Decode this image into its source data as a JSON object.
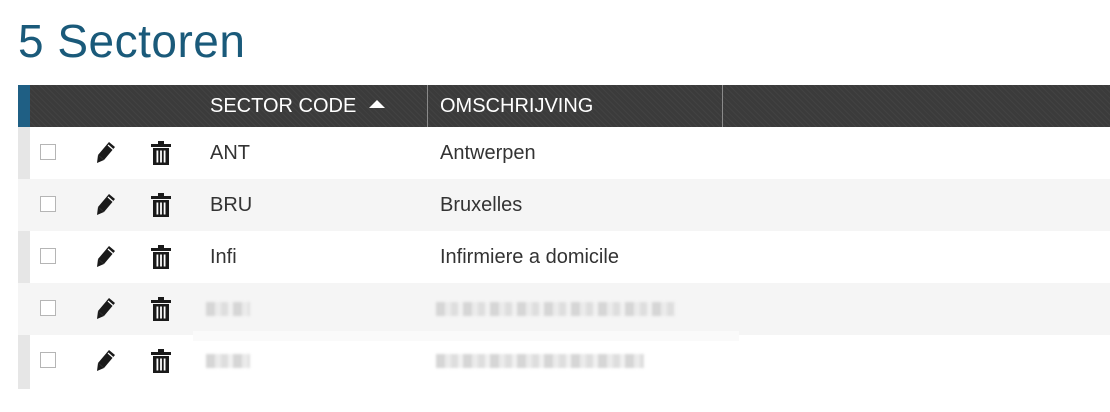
{
  "page": {
    "title": "5 Sectoren"
  },
  "colors": {
    "title": "#1a5a7a",
    "header_bg": "#3b3b3b",
    "accent": "#1f5f84",
    "alt_row": "#f5f5f5"
  },
  "table": {
    "columns": [
      {
        "label": "SECTOR CODE",
        "sort": "ascending"
      },
      {
        "label": "OMSCHRIJVING"
      }
    ],
    "row_actions": {
      "edit_icon": "pencil-icon",
      "delete_icon": "trash-icon"
    },
    "rows": [
      {
        "code": "ANT",
        "description": "Antwerpen",
        "selected": false,
        "redacted": false
      },
      {
        "code": "BRU",
        "description": "Bruxelles",
        "selected": false,
        "redacted": false
      },
      {
        "code": "Infi",
        "description": "Infirmiere a domicile",
        "selected": false,
        "redacted": false
      },
      {
        "code": "",
        "description": "",
        "selected": false,
        "redacted": true
      },
      {
        "code": "",
        "description": "",
        "selected": false,
        "redacted": true
      }
    ]
  }
}
